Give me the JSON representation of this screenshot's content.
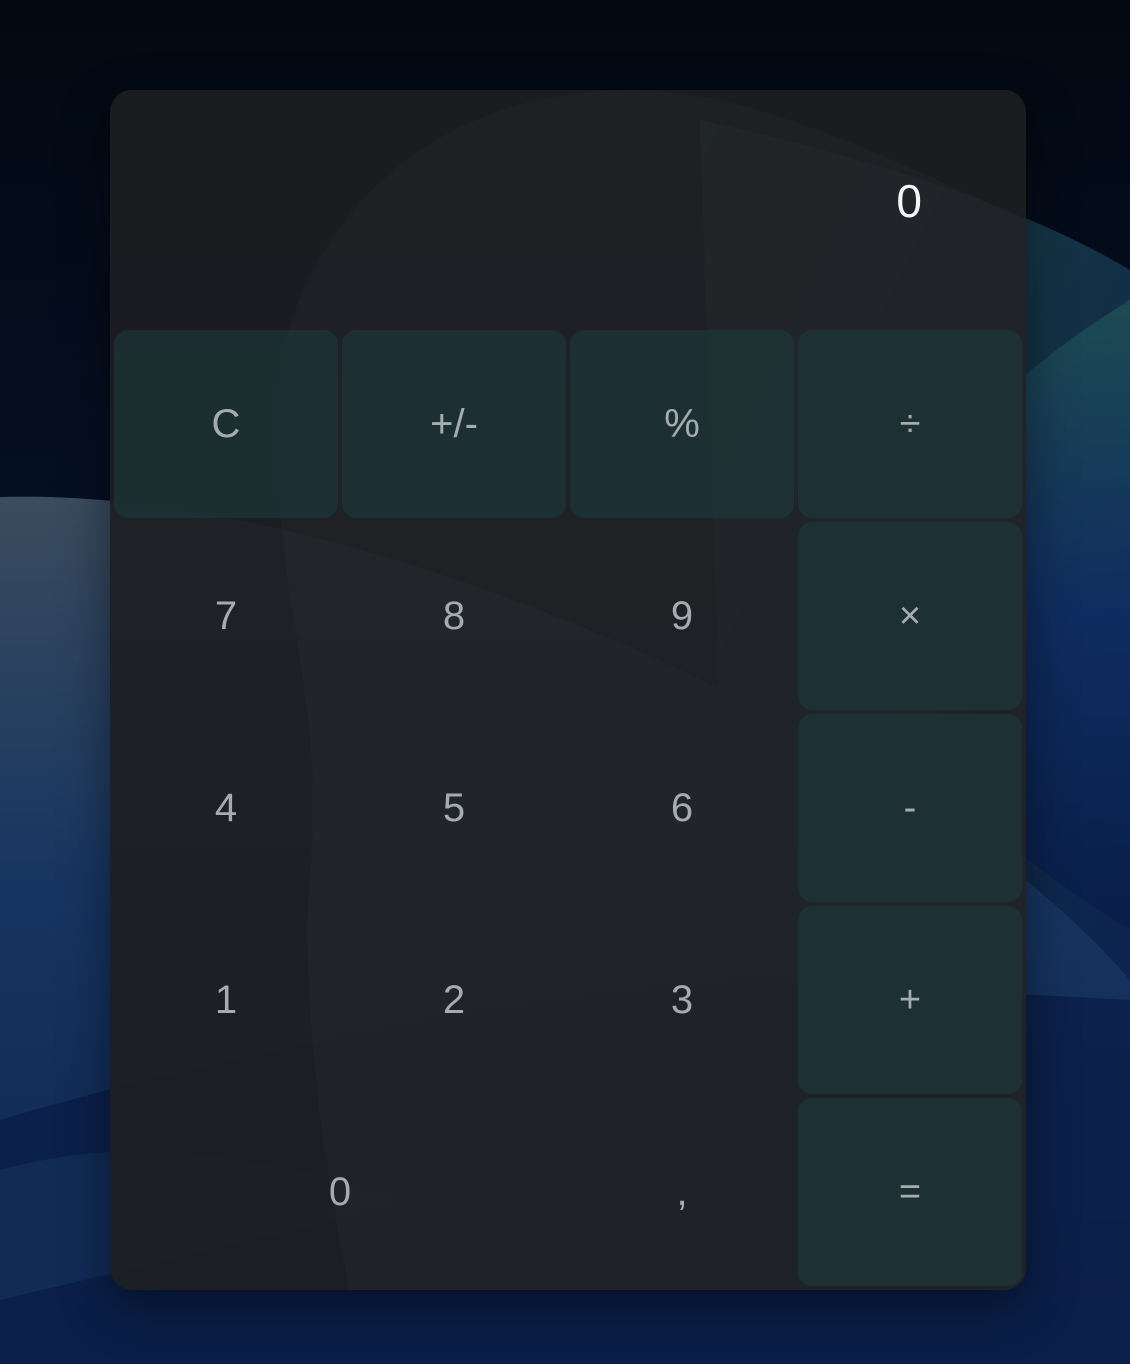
{
  "display": {
    "value": "0"
  },
  "keys": {
    "clear": "C",
    "sign": "+/-",
    "percent": "%",
    "divide": "÷",
    "seven": "7",
    "eight": "8",
    "nine": "9",
    "multiply": "×",
    "four": "4",
    "five": "5",
    "six": "6",
    "subtract": "-",
    "one": "1",
    "two": "2",
    "three": "3",
    "add": "+",
    "zero": "0",
    "decimal": ",",
    "equals": "="
  },
  "colors": {
    "background": "#030a16",
    "panel": "#1d1e21",
    "function_key": "#1c383a",
    "operator_key": "#1c3638",
    "key_text": "#a6abb0",
    "display_text": "#f4f5f6"
  }
}
